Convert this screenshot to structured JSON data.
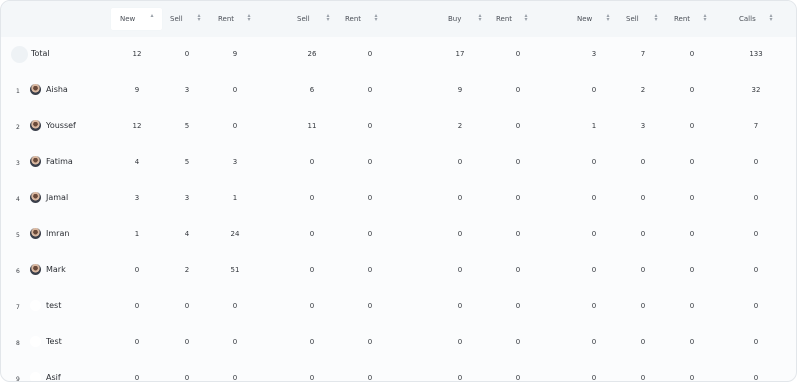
{
  "columns": [
    {
      "key": "new1",
      "label": "New",
      "sort": "asc"
    },
    {
      "key": "sell1",
      "label": "Sell",
      "sort": "both"
    },
    {
      "key": "rent1",
      "label": "Rent",
      "sort": "both"
    },
    {
      "key": "sell2",
      "label": "Sell",
      "sort": "both"
    },
    {
      "key": "rent2",
      "label": "Rent",
      "sort": "both"
    },
    {
      "key": "buy",
      "label": "Buy",
      "sort": "both"
    },
    {
      "key": "rent3",
      "label": "Rent",
      "sort": "both"
    },
    {
      "key": "new2",
      "label": "New",
      "sort": "both"
    },
    {
      "key": "sell3",
      "label": "Sell",
      "sort": "both"
    },
    {
      "key": "rent4",
      "label": "Rent",
      "sort": "both"
    },
    {
      "key": "calls",
      "label": "Calls",
      "sort": "both"
    }
  ],
  "total": {
    "label": "Total",
    "values": [
      "12",
      "0",
      "9",
      "26",
      "0",
      "17",
      "0",
      "3",
      "7",
      "0",
      "133"
    ]
  },
  "rows": [
    {
      "index": "1",
      "name": "Aisha",
      "avatar": "photo",
      "values": [
        "9",
        "3",
        "0",
        "6",
        "0",
        "9",
        "0",
        "0",
        "2",
        "0",
        "32"
      ]
    },
    {
      "index": "2",
      "name": "Youssef",
      "avatar": "photo",
      "values": [
        "12",
        "5",
        "0",
        "11",
        "0",
        "2",
        "0",
        "1",
        "3",
        "0",
        "7"
      ]
    },
    {
      "index": "3",
      "name": "Fatima",
      "avatar": "photo",
      "values": [
        "4",
        "5",
        "3",
        "0",
        "0",
        "0",
        "0",
        "0",
        "0",
        "0",
        "0"
      ]
    },
    {
      "index": "4",
      "name": "Jamal",
      "avatar": "photo",
      "values": [
        "3",
        "3",
        "1",
        "0",
        "0",
        "0",
        "0",
        "0",
        "0",
        "0",
        "0"
      ]
    },
    {
      "index": "5",
      "name": "Imran",
      "avatar": "photo",
      "values": [
        "1",
        "4",
        "24",
        "0",
        "0",
        "0",
        "0",
        "0",
        "0",
        "0",
        "0"
      ]
    },
    {
      "index": "6",
      "name": "Mark",
      "avatar": "photo",
      "values": [
        "0",
        "2",
        "51",
        "0",
        "0",
        "0",
        "0",
        "0",
        "0",
        "0",
        "0"
      ]
    },
    {
      "index": "7",
      "name": "test",
      "avatar": "blank",
      "values": [
        "0",
        "0",
        "0",
        "0",
        "0",
        "0",
        "0",
        "0",
        "0",
        "0",
        "0"
      ]
    },
    {
      "index": "8",
      "name": "Test",
      "avatar": "blank",
      "values": [
        "0",
        "0",
        "0",
        "0",
        "0",
        "0",
        "0",
        "0",
        "0",
        "0",
        "0"
      ]
    },
    {
      "index": "9",
      "name": "Asif",
      "avatar": "blank",
      "values": [
        "0",
        "0",
        "0",
        "0",
        "0",
        "0",
        "0",
        "0",
        "0",
        "0",
        "0"
      ]
    }
  ]
}
